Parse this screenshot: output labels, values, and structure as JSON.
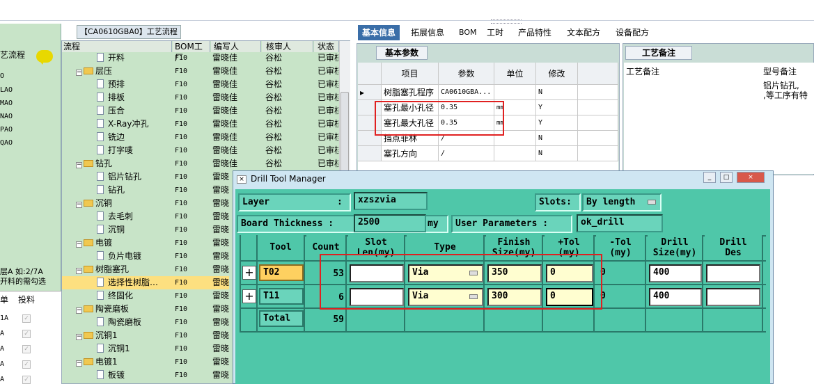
{
  "left_panel": {
    "title": "艺流程",
    "items": [
      "O",
      "LAO",
      "MAO",
      "NAO",
      "PAO",
      "QAO"
    ],
    "note_line1": "层A 如:2/7A",
    "note_line2": "开料的需勾选",
    "table_headers": [
      "单",
      "投料"
    ],
    "table_rows": [
      "1A",
      "A",
      "A",
      "A",
      "A"
    ],
    "check_mark": "✓"
  },
  "tree": {
    "tab_label": "【CA0610GBA0】工艺流程",
    "headers": [
      "流程",
      "BOM工厂",
      "编写人",
      "核审人",
      "状态"
    ],
    "rows": [
      {
        "name": "开料",
        "type": "file",
        "bom": "F10",
        "writer": "雷晓佳",
        "reviewer": "谷松",
        "status": "已审核"
      },
      {
        "name": "层压",
        "type": "folder",
        "bom": "F10",
        "writer": "雷晓佳",
        "reviewer": "谷松",
        "status": "已审核"
      },
      {
        "name": "预排",
        "type": "file",
        "bom": "F10",
        "writer": "雷晓佳",
        "reviewer": "谷松",
        "status": "已审核"
      },
      {
        "name": "排板",
        "type": "file",
        "bom": "F10",
        "writer": "雷晓佳",
        "reviewer": "谷松",
        "status": "已审核"
      },
      {
        "name": "压合",
        "type": "file",
        "bom": "F10",
        "writer": "雷晓佳",
        "reviewer": "谷松",
        "status": "已审核"
      },
      {
        "name": "X-Ray冲孔",
        "type": "file",
        "bom": "F10",
        "writer": "雷晓佳",
        "reviewer": "谷松",
        "status": "已审核"
      },
      {
        "name": "铣边",
        "type": "file",
        "bom": "F10",
        "writer": "雷晓佳",
        "reviewer": "谷松",
        "status": "已审核"
      },
      {
        "name": "打字唛",
        "type": "file",
        "bom": "F10",
        "writer": "雷晓佳",
        "reviewer": "谷松",
        "status": "已审核"
      },
      {
        "name": "钻孔",
        "type": "folder",
        "bom": "F10",
        "writer": "雷晓佳",
        "reviewer": "谷松",
        "status": "已审核"
      },
      {
        "name": "铝片钻孔",
        "type": "file",
        "bom": "F10",
        "writer": "雷晓",
        "reviewer": "",
        "status": ""
      },
      {
        "name": "钻孔",
        "type": "file",
        "bom": "F10",
        "writer": "雷晓",
        "reviewer": "",
        "status": ""
      },
      {
        "name": "沉铜",
        "type": "folder",
        "bom": "F10",
        "writer": "雷晓",
        "reviewer": "",
        "status": ""
      },
      {
        "name": "去毛刺",
        "type": "file",
        "bom": "F10",
        "writer": "雷晓",
        "reviewer": "",
        "status": ""
      },
      {
        "name": "沉铜",
        "type": "file",
        "bom": "F10",
        "writer": "雷晓",
        "reviewer": "",
        "status": ""
      },
      {
        "name": "电镀",
        "type": "folder",
        "bom": "F10",
        "writer": "雷晓",
        "reviewer": "",
        "status": ""
      },
      {
        "name": "负片电镀",
        "type": "file",
        "bom": "F10",
        "writer": "雷晓",
        "reviewer": "",
        "status": ""
      },
      {
        "name": "树脂塞孔",
        "type": "folder",
        "bom": "F10",
        "writer": "雷晓",
        "reviewer": "",
        "status": ""
      },
      {
        "name": "选择性树脂…",
        "type": "file",
        "bom": "F10",
        "writer": "雷晓",
        "reviewer": "",
        "status": ""
      },
      {
        "name": "终固化",
        "type": "file",
        "bom": "F10",
        "writer": "雷晓",
        "reviewer": "",
        "status": ""
      },
      {
        "name": "陶瓷磨板",
        "type": "folder",
        "bom": "F10",
        "writer": "雷晓",
        "reviewer": "",
        "status": ""
      },
      {
        "name": "陶瓷磨板",
        "type": "file",
        "bom": "F10",
        "writer": "雷晓",
        "reviewer": "",
        "status": ""
      },
      {
        "name": "沉铜1",
        "type": "folder",
        "bom": "F10",
        "writer": "雷晓",
        "reviewer": "",
        "status": ""
      },
      {
        "name": "沉铜1",
        "type": "file",
        "bom": "F10",
        "writer": "雷晓",
        "reviewer": "",
        "status": ""
      },
      {
        "name": "电镀1",
        "type": "folder",
        "bom": "F10",
        "writer": "雷晓",
        "reviewer": "",
        "status": ""
      },
      {
        "name": "板镀",
        "type": "file",
        "bom": "F10",
        "writer": "雷晓",
        "reviewer": "",
        "status": ""
      }
    ]
  },
  "right_tabs": [
    "基本信息",
    "拓展信息",
    "BOM",
    "工时",
    "产品特性",
    "文本配方",
    "设备配方"
  ],
  "params": {
    "tab_label": "基本参数",
    "headers": [
      "项目",
      "参数",
      "单位",
      "修改"
    ],
    "rows": [
      {
        "item": "树脂塞孔程序",
        "value": "CA0610GBA...",
        "unit": "",
        "mod": "N"
      },
      {
        "item": "塞孔最小孔径",
        "value": "0.35",
        "unit": "mm",
        "mod": "Y"
      },
      {
        "item": "塞孔最大孔径",
        "value": "0.35",
        "unit": "mm",
        "mod": "Y"
      },
      {
        "item": "挡点菲林",
        "value": "/",
        "unit": "",
        "mod": "N"
      },
      {
        "item": "塞孔方向",
        "value": "/",
        "unit": "",
        "mod": "N"
      }
    ],
    "row_marker": "▸"
  },
  "craft": {
    "tab_label": "工艺备注",
    "col1": "工艺备注",
    "col2": "型号备注",
    "note_line1": "铝片钻孔,",
    "note_line2": ",等工序有特"
  },
  "dialog": {
    "title": "Drill Tool Manager",
    "layer_label": "Layer",
    "layer_colon": ":",
    "layer_value": "xzszvia",
    "slots_label": "Slots:",
    "slots_value": "By length",
    "thickness_label": "Board Thickness :",
    "thickness_value": "2500",
    "thickness_unit": "my",
    "user_params_label": "User Parameters :",
    "user_params_value": "ok_drill",
    "headers": [
      {
        "l1": "Tool",
        "l2": ""
      },
      {
        "l1": "Count",
        "l2": ""
      },
      {
        "l1": "Slot",
        "l2": "Len(my)"
      },
      {
        "l1": "Type",
        "l2": ""
      },
      {
        "l1": "Finish",
        "l2": "Size(my)"
      },
      {
        "l1": "+Tol",
        "l2": "(my)"
      },
      {
        "l1": "-Tol",
        "l2": "(my)"
      },
      {
        "l1": "Drill",
        "l2": "Size(my)"
      },
      {
        "l1": "Drill",
        "l2": "Des"
      }
    ],
    "rows": [
      {
        "tool": "T02",
        "count": "53",
        "slot": "",
        "type": "Via",
        "finish": "350",
        "ptol": "0",
        "ntol": "0",
        "drill": "400",
        "des": ""
      },
      {
        "tool": "T11",
        "count": "6",
        "slot": "",
        "type": "Via",
        "finish": "300",
        "ptol": "0",
        "ntol": "0",
        "drill": "400",
        "des": ""
      }
    ],
    "total_label": "Total",
    "total_count": "59",
    "plus": "+"
  }
}
